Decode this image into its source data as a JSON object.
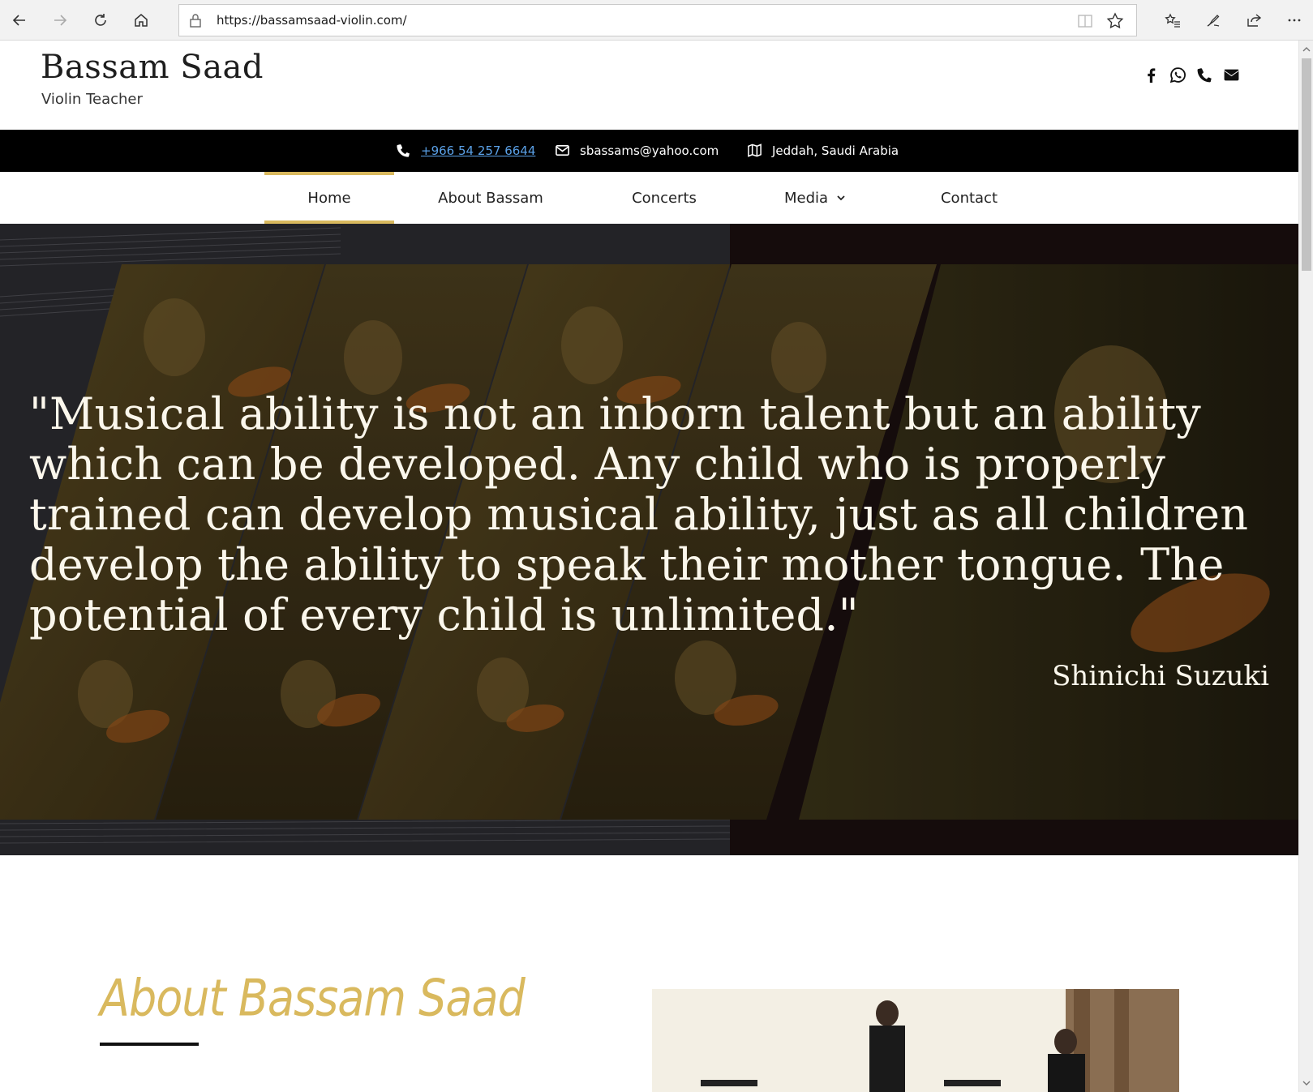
{
  "browser": {
    "url": "https://bassamsaad-violin.com/",
    "icons": [
      "back-icon",
      "forward-icon",
      "refresh-icon",
      "home-icon",
      "lock-icon",
      "reading-view-icon",
      "favorite-star-icon",
      "favorites-list-icon",
      "pen-icon",
      "share-icon",
      "more-icon"
    ]
  },
  "header": {
    "title": "Bassam Saad",
    "tagline": "Violin Teacher",
    "social_icons": [
      "facebook-icon",
      "whatsapp-icon",
      "phone-icon",
      "email-icon"
    ]
  },
  "contact_bar": {
    "phone": "+966 54 257 6644",
    "email": "sbassams@yahoo.com",
    "location": "Jeddah, Saudi Arabia"
  },
  "nav": {
    "items": [
      {
        "label": "Home",
        "active": true
      },
      {
        "label": "About Bassam",
        "active": false
      },
      {
        "label": "Concerts",
        "active": false
      },
      {
        "label": "Media",
        "active": false,
        "has_dropdown": true
      },
      {
        "label": "Contact",
        "active": false
      }
    ]
  },
  "hero": {
    "quote": "\"Musical ability is not an inborn talent but an ability which can be developed. Any child who is properly trained can develop musical ability, just as all children develop the ability to speak their mother tongue. The potential of every child is unlimited.\"",
    "author": "Shinichi Suzuki"
  },
  "about": {
    "title": "About Bassam Saad"
  },
  "colors": {
    "accent_gold": "#d9b95e",
    "info_bar": "#000000",
    "link_blue": "#5aa0e6"
  }
}
